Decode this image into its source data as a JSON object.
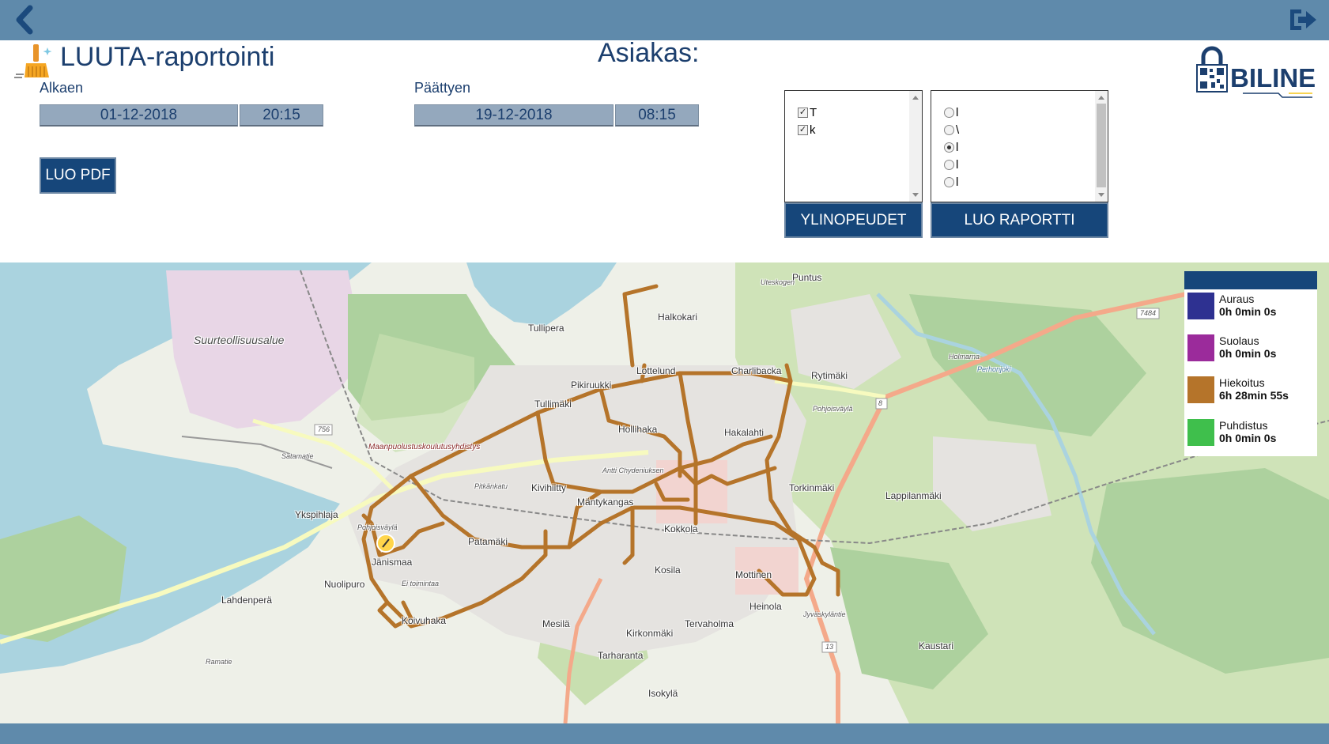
{
  "header": {
    "back_icon": "chevron-left-icon",
    "logout_icon": "logout-icon",
    "bar_color": "#5f8aab"
  },
  "title": {
    "app_icon": "broom-icon",
    "text": "LUUTA-raportointi"
  },
  "customer": {
    "label": "Asiakas:"
  },
  "start": {
    "label": "Alkaen",
    "date": "01-12-2018",
    "time": "20:15"
  },
  "end": {
    "label": "Päättyen",
    "date": "19-12-2018",
    "time": "08:15"
  },
  "buttons": {
    "pdf": "LUO PDF",
    "overspeed": "YLINOPEUDET",
    "create_report": "LUO RAPORTTI"
  },
  "vehicle_list": {
    "items": [
      {
        "label": "T",
        "checked": true
      },
      {
        "label": "k",
        "checked": true
      }
    ]
  },
  "report_list": {
    "items": [
      {
        "label": "l",
        "selected": false
      },
      {
        "label": "\\",
        "selected": false
      },
      {
        "label": "l",
        "selected": true
      },
      {
        "label": "l",
        "selected": false
      },
      {
        "label": "l",
        "selected": false
      }
    ]
  },
  "brand": {
    "name": "BILINE",
    "logo_icon": "biline-lock-qr-logo"
  },
  "map": {
    "route_color": "#b5742a",
    "labels": {
      "puntus": "Puntus",
      "uteskogen": "Uteskogen",
      "halkokari": "Halkokari",
      "tullipera": "Tullipera",
      "suurteollisuusalue": "Suurteollisuusalue",
      "lottelund": "Lottelund",
      "charlibacka": "Charlibacka",
      "rytimaki": "Rytimäki",
      "pikiruukki": "Pikiruukki",
      "tullimaki": "Tullimäki",
      "holmarna": "Holmarna",
      "perhonjoki": "Perhonjoki",
      "road_7484": "7484",
      "hollihaka": "Hollihaka",
      "hakalahti": "Hakalahti",
      "pohjoisvayla": "Pohjoisväylä",
      "maanpuolustus": "Maanpuolustuskoulutusyhdistys",
      "satamatie": "Satamatie",
      "road_756": "756",
      "road_8": "8",
      "pitkankatu": "Pitkänkatu",
      "antti_chydenius": "Antti Chydeniuksen",
      "kivihitty": "Kivihiitty",
      "torkinmaki": "Torkinmäki",
      "ykspihlaja": "Ykspihlaja",
      "mantykangas": "Mäntykangas",
      "lappilanmaki": "Lappilanmäki",
      "pohjoisvayla2": "Pohjoisväylä",
      "patamaki": "Patamäki",
      "kokkola": "Kokkola",
      "janismaa": "Jänismaa",
      "nuolipuro": "Nuolipuro",
      "ei_toimintaa": "Ei toimintaa",
      "kosila": "Kosila",
      "mottinen": "Mottinen",
      "lahdenpera": "Lahdenperä",
      "heinola": "Heinola",
      "koivuhaka": "Koivuhaka",
      "mesila": "Mesilä",
      "tervaholma": "Tervaholma",
      "kirkonmaki": "Kirkonmäki",
      "kaustari": "Kaustari",
      "tarharanta": "Tarharanta",
      "road_13": "13",
      "isokyla": "Isokylä",
      "ramatie": "Ramatie",
      "jyvaskylantie": "Jyväskyläntie"
    }
  },
  "legend": {
    "items": [
      {
        "name": "Auraus",
        "duration": "0h 0min 0s",
        "color": "#2e3191"
      },
      {
        "name": "Suolaus",
        "duration": "0h 0min 0s",
        "color": "#9b2b9b"
      },
      {
        "name": "Hiekoitus",
        "duration": "6h 28min 55s",
        "color": "#b5742a"
      },
      {
        "name": "Puhdistus",
        "duration": "0h 0min 0s",
        "color": "#3fbf4c"
      }
    ]
  }
}
